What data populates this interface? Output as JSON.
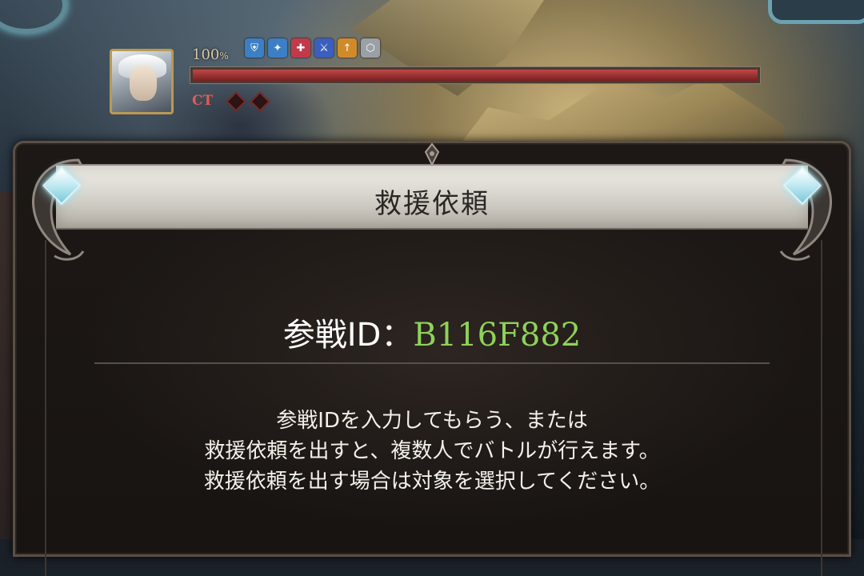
{
  "unit_status": {
    "hp_value": "100",
    "hp_unit": "%",
    "hp_fraction": 1.0,
    "ct_label": "CT",
    "ct_charges": [
      false,
      false
    ],
    "buffs": [
      {
        "icon": "def-down-icon",
        "color": "#3d7fc4"
      },
      {
        "icon": "debuff-resist-down-icon",
        "color": "#3d7fc4"
      },
      {
        "icon": "atk-up-red-icon",
        "color": "#c23a4a"
      },
      {
        "icon": "sword-blue-icon",
        "color": "#3b5fbf"
      },
      {
        "icon": "orange-up-icon",
        "color": "#d08a2a"
      },
      {
        "icon": "shield-white-icon",
        "color": "#9aa0a6"
      }
    ]
  },
  "dialog": {
    "title": "救援依頼",
    "id_label": "参戦ID：",
    "id_value": "B116F882",
    "id_value_color": "#8fd15a",
    "description_lines": [
      "参戦IDを入力してもらう、または",
      "救援依頼を出すと、複数人でバトルが行えます。",
      "救援依頼を出す場合は対象を選択してください。"
    ]
  }
}
